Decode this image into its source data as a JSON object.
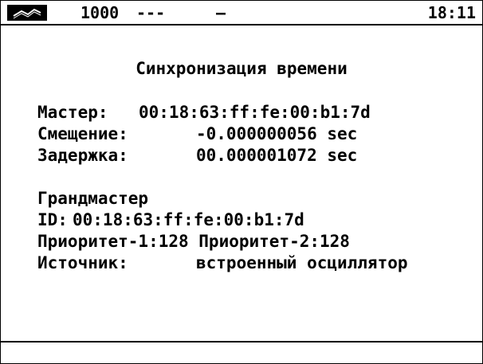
{
  "status_bar": {
    "speed": "1000",
    "dashes": "---",
    "dash2": "–",
    "time": "18:11"
  },
  "title": "Синхронизация времени",
  "master": {
    "label": "Мастер:",
    "value": "00:18:63:ff:fe:00:b1:7d"
  },
  "offset": {
    "label": "Смещение:",
    "value": "-0.000000056 sec"
  },
  "delay": {
    "label": "Задержка:",
    "value": "00.000001072 sec"
  },
  "grandmaster": {
    "heading": "Грандмастер",
    "id_label": "ID:",
    "id_value": "00:18:63:ff:fe:00:b1:7d",
    "priority_line": "Приоритет-1:128 Приоритет-2:128",
    "source_label": "Источник:",
    "source_value": "встроенный осциллятор"
  }
}
